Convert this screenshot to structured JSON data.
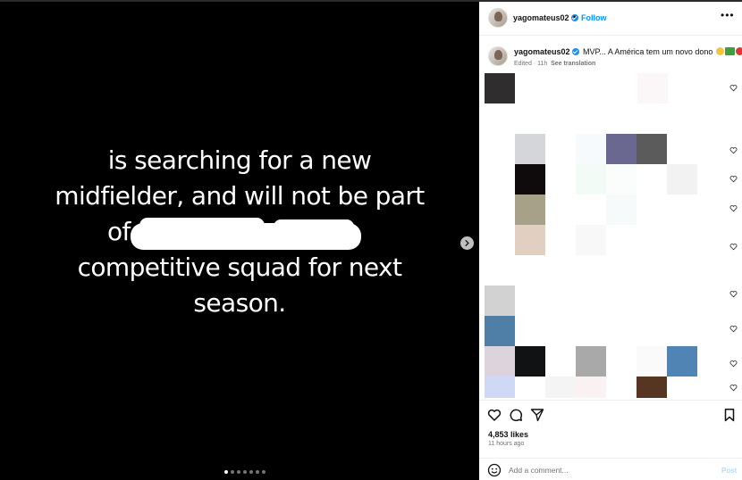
{
  "caption_lines": [
    "is searching for a new",
    "midfielder, and will not be part",
    "of",
    "competitive squad for next",
    "season."
  ],
  "header": {
    "username": "yagomateus02",
    "separator": "•",
    "follow_label": "Follow",
    "more_label": "•••"
  },
  "post": {
    "username": "yagomateus02",
    "text": "MVP... A América tem um novo dono",
    "edited": "Edited · 11h",
    "translate_label": "See translation"
  },
  "likes": "4,853 likes",
  "time_ago": "11 hours ago",
  "comment_placeholder": "Add a comment...",
  "post_button": "Post",
  "carousel": {
    "slides": 7,
    "active": 0
  },
  "colors": {
    "accent": "#0095f6",
    "verified": "#1d8cf0"
  }
}
